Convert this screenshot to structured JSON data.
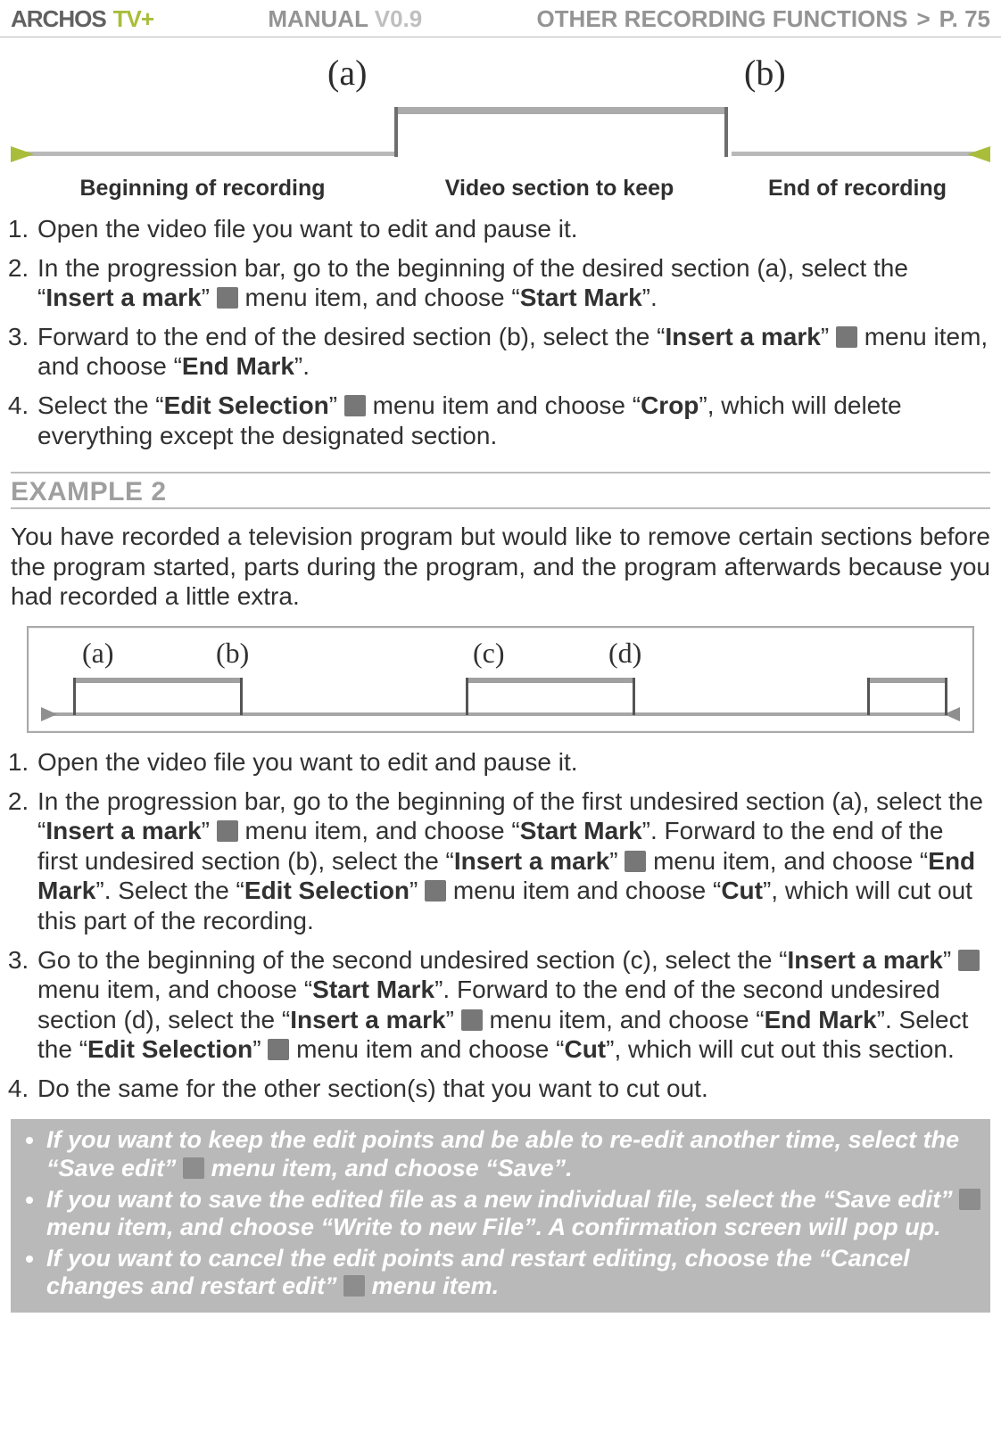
{
  "header": {
    "logo": "ARCHOS",
    "tv": "TV+",
    "manual": "MANUAL",
    "version": "V0.9",
    "section": "OTHER RECORDING FUNCTIONS",
    "gt": ">",
    "page": "P. 75"
  },
  "diagram1": {
    "a": "(a)",
    "b": "(b)",
    "sub1": "Beginning of recording",
    "sub2": "Video section to keep",
    "sub3": "End of recording"
  },
  "steps1": {
    "s1": "Open the video file you want to edit and pause it.",
    "s2a": "In the progression bar, go to the beginning of the desired section (a), select the “",
    "s2b": "Insert a mark",
    "s2c": "” ",
    "s2d": " menu item, and choose “",
    "s2e": "Start Mark",
    "s2f": "”.",
    "s3a": "Forward to the end of the desired section (b), select the “",
    "s3b": "Insert a mark",
    "s3c": "” ",
    "s3d": " menu item, and choose “",
    "s3e": "End Mark",
    "s3f": "”.",
    "s4a": "Select the “",
    "s4b": "Edit Selection",
    "s4c": "” ",
    "s4d": " menu item and choose “",
    "s4e": "Crop",
    "s4f": "”, which will delete everything except the designated section."
  },
  "example2": {
    "title": "EXAMPLE 2",
    "intro": "You have recorded a television program but would like to remove certain sections before the program started, parts during the program, and the program afterwards because you had recorded a little extra.",
    "labels": {
      "a": "(a)",
      "b": "(b)",
      "c": "(c)",
      "d": "(d)"
    }
  },
  "steps2": {
    "s1": "Open the video file you want to edit and pause it.",
    "s2a": "In the progression bar, go to the beginning of the first undesired section (a), select the “",
    "s2b": "Insert a mark",
    "s2c": "” ",
    "s2d": " menu item, and choose “",
    "s2e": "Start Mark",
    "s2f": "”. Forward to the end of the first undesired section (b), select the “",
    "s2g": "Insert a mark",
    "s2h": "” ",
    "s2i": " menu item, and choose “",
    "s2j": "End Mark",
    "s2k": "”. Select the “",
    "s2l": "Edit Selection",
    "s2m": "” ",
    "s2n": " menu item and choose “",
    "s2o": "Cut",
    "s2p": "”, which will cut out this part of the recording.",
    "s3a": "Go to the beginning of the second undesired section (c), select the “",
    "s3b": "Insert a mark",
    "s3c": "” ",
    "s3d": " menu item, and choose “",
    "s3e": "Start Mark",
    "s3f": "”. Forward to the end of the second undesired section (d), select the “",
    "s3g": "Insert a mark",
    "s3h": "” ",
    "s3i": " menu item, and choose “",
    "s3j": "End Mark",
    "s3k": "”. Select the “",
    "s3l": "Edit Selection",
    "s3m": "” ",
    "s3n": " menu item and choose “",
    "s3o": "Cut",
    "s3p": "”, which will cut out this section.",
    "s4": "Do the same for the other section(s) that you want to cut out."
  },
  "notes": {
    "n1a": "If you want to keep the edit points and be able to re-edit another time, select the “Save edit” ",
    "n1b": " menu item, and choose “Save”.",
    "n2a": "If you want to save the edited file as a new individual file, select the “Save edit” ",
    "n2b": " menu item, and choose “Write to new File”. A confirmation screen will pop up.",
    "n3a": "If you want to cancel the edit points and restart editing, choose the “Cancel changes and restart edit” ",
    "n3b": " menu item."
  }
}
